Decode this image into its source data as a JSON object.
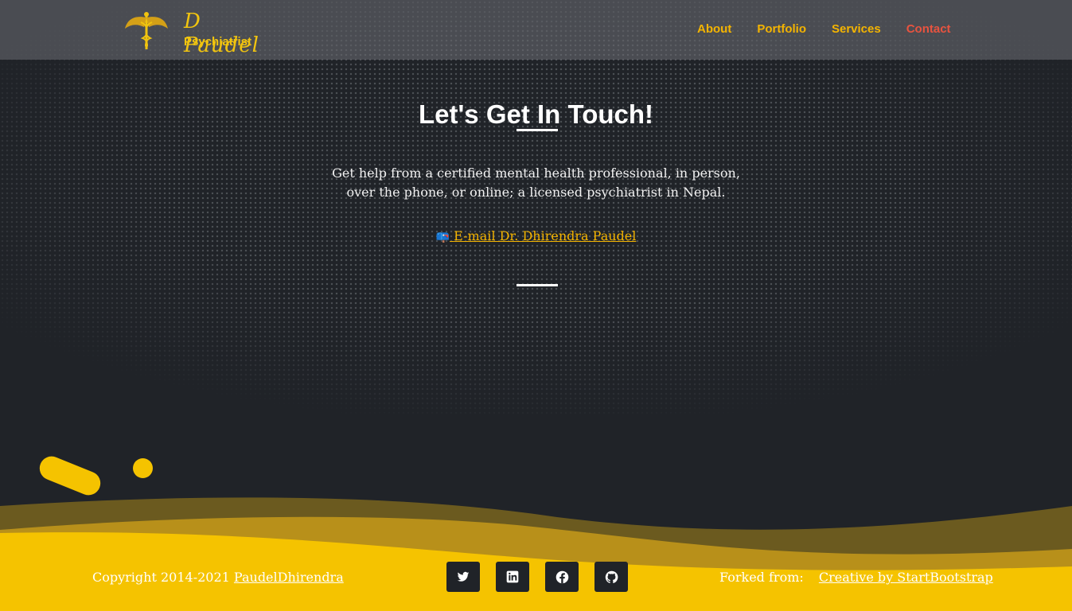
{
  "colors": {
    "background": "#202328",
    "accent": "#f4b400",
    "active_nav": "#e8533f",
    "footer_yellow": "#f5c300"
  },
  "brand": {
    "name": "D Paudel",
    "subtitle": "Psychiatrist",
    "emblem_icon": "caduceus-wings-icon"
  },
  "nav": {
    "items": [
      {
        "label": "About"
      },
      {
        "label": "Portfolio"
      },
      {
        "label": "Services"
      },
      {
        "label": "Contact"
      }
    ]
  },
  "main": {
    "title": "Let's Get In Touch!",
    "lead_line1": "Get help from a certified mental health professional, in person,",
    "lead_line2": "over the phone, or online; a licensed psychiatrist in Nepal.",
    "email_icon": "mailbox-icon",
    "email_label": "E-mail Dr. Dhirendra Paudel"
  },
  "footer": {
    "copyright": "Copyright 2014-2021",
    "author_link": "PaudelDhirendra",
    "forked_label": "Forked from:",
    "forked_link": "Creative by StartBootstrap",
    "socials": [
      {
        "icon": "twitter-icon"
      },
      {
        "icon": "linkedin-icon"
      },
      {
        "icon": "facebook-icon"
      },
      {
        "icon": "github-icon"
      }
    ]
  }
}
